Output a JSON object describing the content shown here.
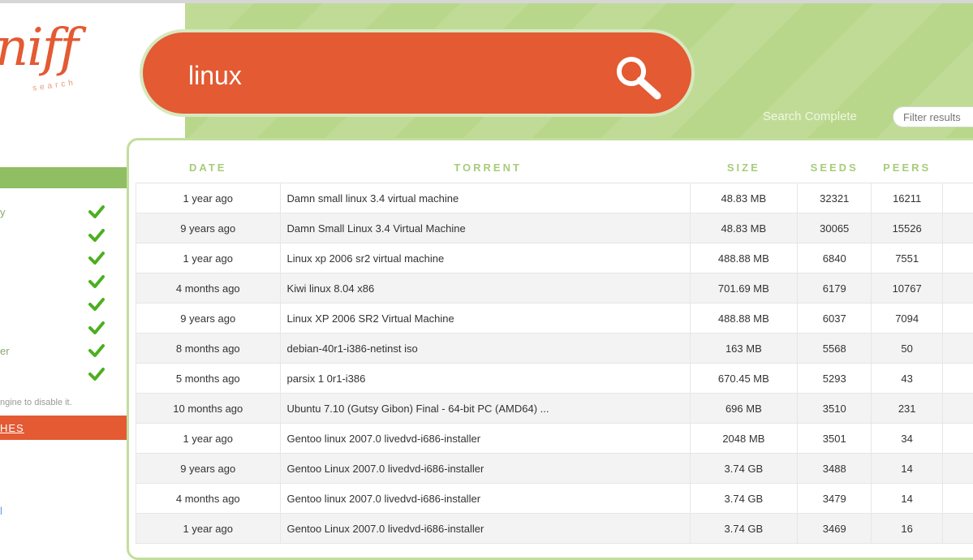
{
  "logo": {
    "text": "niff",
    "tagline": "search"
  },
  "search": {
    "query": "linux",
    "status": "Search Complete",
    "filter_placeholder": "Filter results"
  },
  "sidebar": {
    "engines": [
      {
        "label": "y",
        "checked": true
      },
      {
        "label": "",
        "checked": true
      },
      {
        "label": "",
        "checked": true
      },
      {
        "label": "",
        "checked": true
      },
      {
        "label": "",
        "checked": true
      },
      {
        "label": "",
        "checked": true
      },
      {
        "label": "er",
        "checked": true
      },
      {
        "label": "",
        "checked": true
      }
    ],
    "note": "ngine to disable it.",
    "link": "HES",
    "small_link": "l"
  },
  "table": {
    "headers": [
      "DATE",
      "TORRENT",
      "SIZE",
      "SEEDS",
      "PEERS",
      ""
    ],
    "rows": [
      {
        "date": "1 year ago",
        "name": "Damn small linux 3.4 virtual machine",
        "size": "48.83 MB",
        "seeds": "32321",
        "peers": "16211"
      },
      {
        "date": "9 years ago",
        "name": "Damn Small Linux 3.4 Virtual Machine",
        "size": "48.83 MB",
        "seeds": "30065",
        "peers": "15526"
      },
      {
        "date": "1 year ago",
        "name": "Linux xp 2006 sr2 virtual machine",
        "size": "488.88 MB",
        "seeds": "6840",
        "peers": "7551"
      },
      {
        "date": "4 months ago",
        "name": "Kiwi linux 8.04 x86",
        "size": "701.69 MB",
        "seeds": "6179",
        "peers": "10767"
      },
      {
        "date": "9 years ago",
        "name": "Linux XP 2006 SR2 Virtual Machine",
        "size": "488.88 MB",
        "seeds": "6037",
        "peers": "7094"
      },
      {
        "date": "8 months ago",
        "name": "debian-40r1-i386-netinst iso",
        "size": "163 MB",
        "seeds": "5568",
        "peers": "50"
      },
      {
        "date": "5 months ago",
        "name": "parsix 1 0r1-i386",
        "size": "670.45 MB",
        "seeds": "5293",
        "peers": "43"
      },
      {
        "date": "10 months ago",
        "name": "Ubuntu 7.10 (Gutsy Gibon) Final - 64-bit PC (AMD64) ...",
        "size": "696 MB",
        "seeds": "3510",
        "peers": "231"
      },
      {
        "date": "1 year ago",
        "name": "Gentoo linux 2007.0 livedvd-i686-installer",
        "size": "2048 MB",
        "seeds": "3501",
        "peers": "34"
      },
      {
        "date": "9 years ago",
        "name": "Gentoo Linux 2007.0 livedvd-i686-installer",
        "size": "3.74 GB",
        "seeds": "3488",
        "peers": "14"
      },
      {
        "date": "4 months ago",
        "name": "Gentoo linux 2007.0 livedvd-i686-installer",
        "size": "3.74 GB",
        "seeds": "3479",
        "peers": "14"
      },
      {
        "date": "1 year ago",
        "name": "Gentoo Linux 2007.0 livedvd-i686-installer",
        "size": "3.74 GB",
        "seeds": "3469",
        "peers": "16"
      }
    ]
  },
  "colors": {
    "accent": "#e35a33",
    "green": "#b9d78a",
    "check": "#4caf20"
  }
}
